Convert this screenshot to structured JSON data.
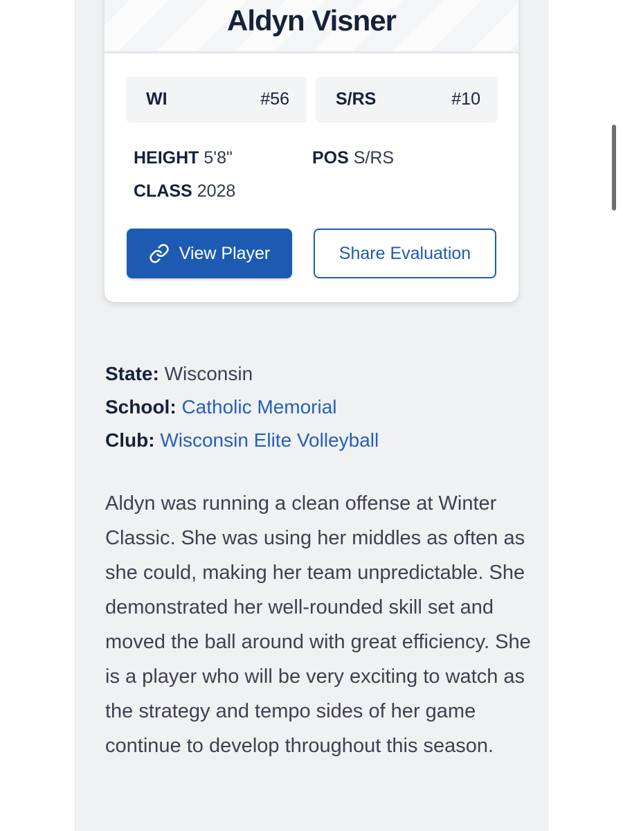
{
  "player": {
    "name": "Aldyn Visner"
  },
  "rankings": [
    {
      "label": "WI",
      "rank": "#56"
    },
    {
      "label": "S/RS",
      "rank": "#10"
    }
  ],
  "stats": {
    "height_label": "HEIGHT",
    "height_value": "5'8\"",
    "class_label": "CLASS",
    "class_value": "2028",
    "pos_label": "POS",
    "pos_value": "S/RS"
  },
  "buttons": {
    "view_player": "View Player",
    "share_evaluation": "Share Evaluation"
  },
  "info": {
    "state_label": "State:",
    "state_value": "Wisconsin",
    "school_label": "School:",
    "school_value": "Catholic Memorial",
    "club_label": "Club:",
    "club_value": "Wisconsin Elite Volleyball"
  },
  "evaluation": {
    "text": "Aldyn was running a clean offense at Winter Classic. She was using her middles as often as she could, making her team unpredictable. She demonstrated her well-rounded skill set and moved the ball around with great efficiency. She is a player who will be very exciting to watch as the strategy and tempo sides of her game continue to develop throughout this season."
  },
  "colors": {
    "accent": "#1d5bb2",
    "link": "#2361b8",
    "heading": "#16213a",
    "background": "#f0f1f3"
  },
  "icons": {
    "view_player_icon": "link-icon"
  }
}
